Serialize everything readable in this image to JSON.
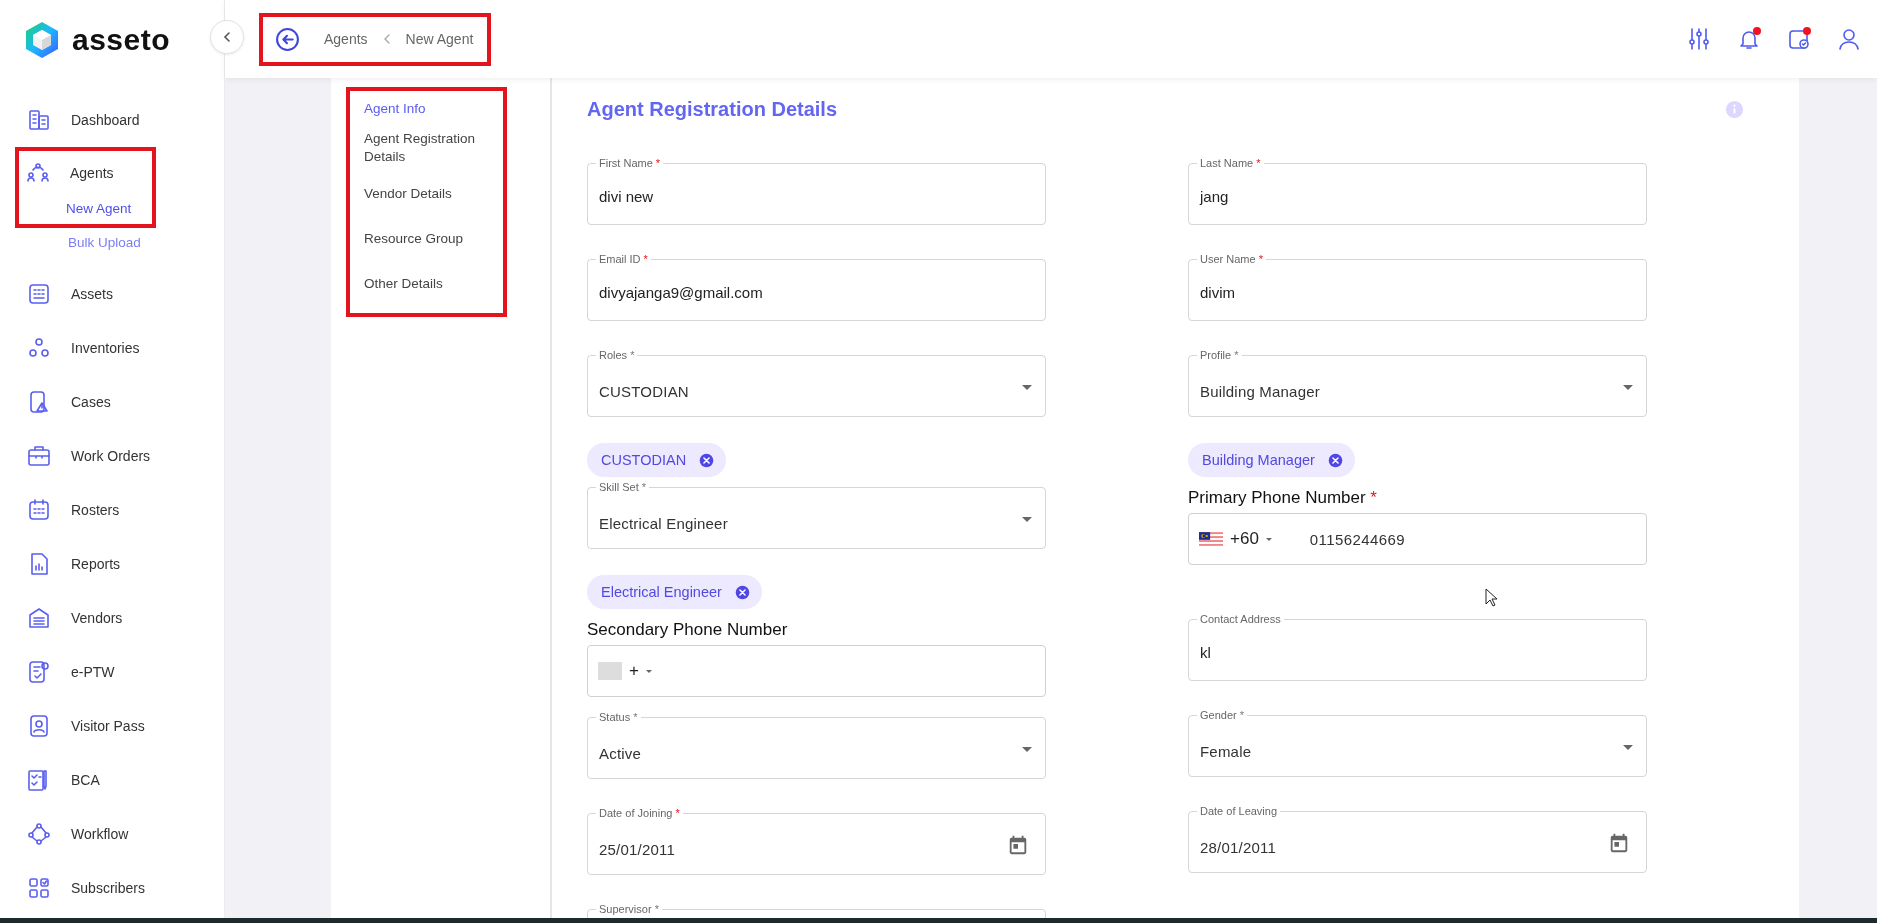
{
  "brand": {
    "name": "asseto"
  },
  "sidebar": {
    "items": [
      {
        "label": "Dashboard",
        "highlighted": false
      },
      {
        "label": "Agents",
        "highlighted": true,
        "children": [
          {
            "label": "New Agent",
            "selected": true,
            "highlighted": true
          },
          {
            "label": "Bulk Upload",
            "selected": false,
            "highlighted": false
          }
        ]
      },
      {
        "label": "Assets",
        "highlighted": false
      },
      {
        "label": "Inventories",
        "highlighted": false
      },
      {
        "label": "Cases",
        "highlighted": false
      },
      {
        "label": "Work Orders",
        "highlighted": false
      },
      {
        "label": "Rosters",
        "highlighted": false
      },
      {
        "label": "Reports",
        "highlighted": false
      },
      {
        "label": "Vendors",
        "highlighted": false
      },
      {
        "label": "e-PTW",
        "highlighted": false
      },
      {
        "label": "Visitor Pass",
        "highlighted": false
      },
      {
        "label": "BCA",
        "highlighted": false
      },
      {
        "label": "Workflow",
        "highlighted": false
      },
      {
        "label": "Subscribers",
        "highlighted": false
      }
    ]
  },
  "topbar": {
    "breadcrumb": {
      "highlighted": true,
      "items": [
        "Agents",
        "New Agent"
      ]
    },
    "actions": [
      {
        "kind": "sliders",
        "dot": false
      },
      {
        "kind": "bell",
        "dot": true
      },
      {
        "kind": "calendar",
        "dot": true
      },
      {
        "kind": "user",
        "dot": false
      }
    ]
  },
  "section_nav": {
    "highlighted": true,
    "items": [
      {
        "label": "Agent Info",
        "selected": true
      },
      {
        "label": "Agent Registration Details",
        "selected": false
      },
      {
        "label": "Vendor Details",
        "selected": false
      },
      {
        "label": "Resource Group",
        "selected": false
      },
      {
        "label": "Other Details",
        "selected": false
      }
    ]
  },
  "form": {
    "title": "Agent Registration Details",
    "columns": [
      [
        {
          "kind": "text",
          "label": "First Name",
          "mark": "*",
          "mark_red": true,
          "value": "divi new"
        },
        {
          "kind": "text",
          "label": "Email ID",
          "mark": "*",
          "mark_red": true,
          "value": "divyajanga9@gmail.com"
        },
        {
          "kind": "select",
          "label": "Roles",
          "mark": "*",
          "mark_red": false,
          "value": "CUSTODIAN"
        },
        {
          "kind": "chip",
          "label": "CUSTODIAN"
        },
        {
          "kind": "select",
          "label": "Skill Set",
          "mark": "*",
          "mark_red": false,
          "value": "Electrical Engineer"
        },
        {
          "kind": "chip",
          "label": "Electrical Engineer"
        },
        {
          "kind": "phone",
          "label": "Secondary Phone Number",
          "flag_shown": false,
          "dial_code": "+"
        },
        {
          "kind": "select",
          "label": "Status",
          "mark": "*",
          "mark_red": false,
          "value": "Active"
        },
        {
          "kind": "date",
          "label": "Date of Joining",
          "mark": "*",
          "mark_red": true,
          "value": "25/01/2011"
        },
        {
          "kind": "text",
          "label": "Supervisor",
          "mark": "*",
          "mark_red": false
        }
      ],
      [
        {
          "kind": "text",
          "label": "Last Name",
          "mark": "*",
          "mark_red": true,
          "value": "jang"
        },
        {
          "kind": "text",
          "label": "User Name",
          "mark": "*",
          "mark_red": true,
          "value": "divim"
        },
        {
          "kind": "select",
          "label": "Profile",
          "mark": "*",
          "mark_red": false,
          "value": "Building Manager"
        },
        {
          "kind": "chip",
          "label": "Building Manager"
        },
        {
          "kind": "phone",
          "label": "Primary Phone Number",
          "mark": "*",
          "mark_red": true,
          "flag_shown": true,
          "dial_code": "+60",
          "value": "01156244669"
        },
        {
          "kind": "text",
          "label": "Contact Address",
          "value": "kl"
        },
        {
          "kind": "select",
          "label": "Gender",
          "mark": "*",
          "mark_red": false,
          "value": "Female"
        },
        {
          "kind": "date",
          "label": "Date of Leaving",
          "value": "28/01/2011"
        }
      ]
    ]
  }
}
